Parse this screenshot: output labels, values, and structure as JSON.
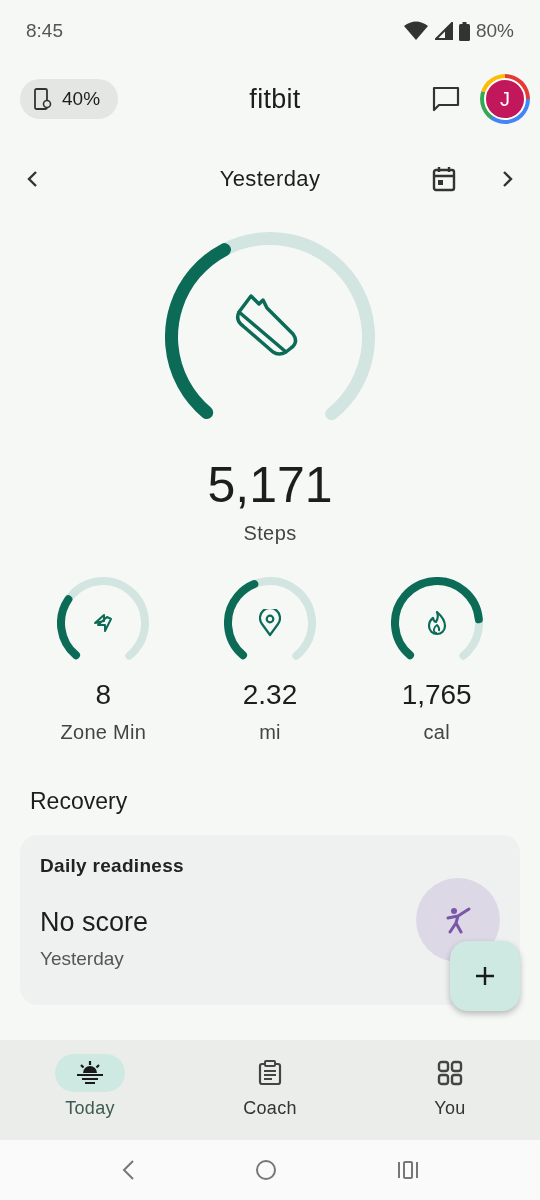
{
  "status_bar": {
    "time": "8:45",
    "battery": "80%"
  },
  "header": {
    "device_battery": "40%",
    "title": "fitbit",
    "avatar": "J"
  },
  "date_nav": {
    "label": "Yesterday"
  },
  "steps": {
    "value": "5,171",
    "label": "Steps",
    "level": 0.4
  },
  "stats": [
    {
      "kind": "zone",
      "value": "8",
      "label": "Zone Min",
      "level": 0.3
    },
    {
      "kind": "distance",
      "value": "2.32",
      "label": "mi",
      "level": 0.42
    },
    {
      "kind": "calories",
      "value": "1,765",
      "label": "cal",
      "level": 0.8
    }
  ],
  "section_title": "Recovery",
  "readiness_card": {
    "title": "Daily readiness",
    "score": "No score",
    "date": "Yesterday"
  },
  "bottom_nav": [
    {
      "kind": "today",
      "label": "Today",
      "selected": true
    },
    {
      "kind": "coach",
      "label": "Coach",
      "selected": false
    },
    {
      "kind": "you",
      "label": "You",
      "selected": false
    }
  ]
}
